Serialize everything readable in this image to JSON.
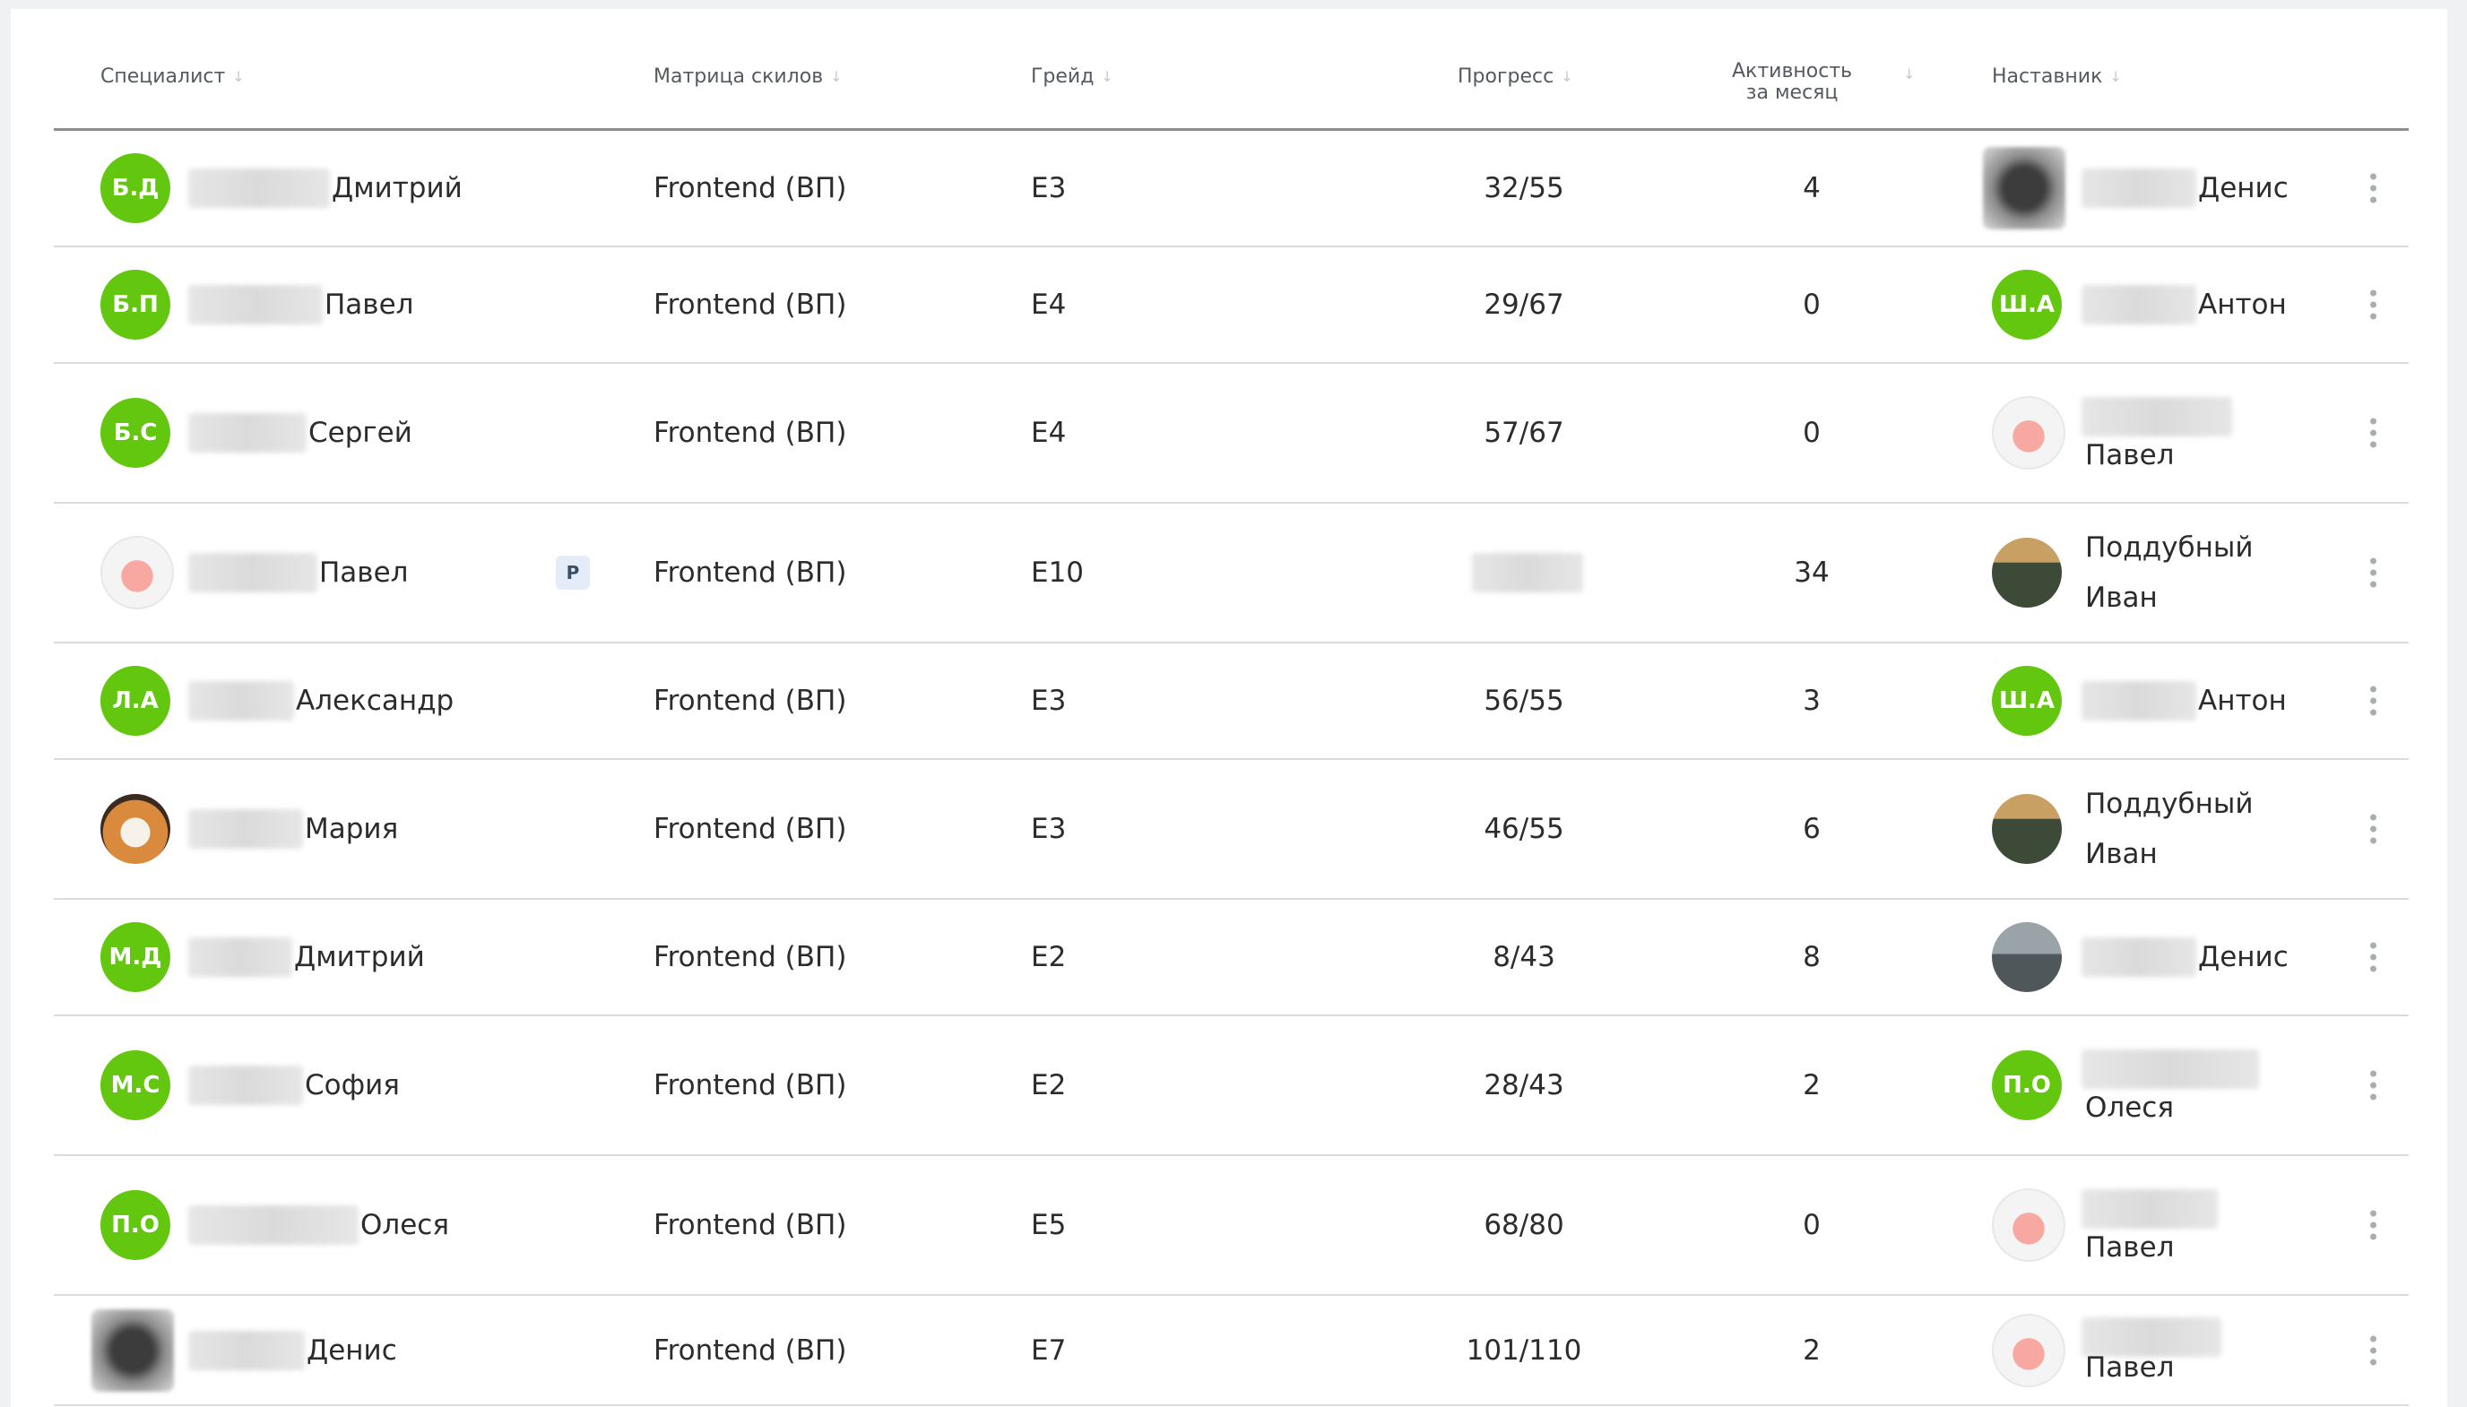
{
  "headers": {
    "specialist": "Специалист",
    "matrix": "Матрица скилов",
    "grade": "Грейд",
    "progress": "Прогресс",
    "activity_line1": "Активность",
    "activity_line2": "за месяц",
    "mentor": "Наставник"
  },
  "rows": [
    {
      "initials": "Б.Д",
      "avatar": "initials",
      "name": "Дмитрий",
      "matrix": "Frontend (ВП)",
      "grade": "E3",
      "progress": "32/55",
      "activity": "4",
      "mentor_avatar": "blur-photo",
      "mentor_line1": "Денис",
      "mentor_line2": ""
    },
    {
      "initials": "Б.П",
      "avatar": "initials",
      "name": "Павел",
      "matrix": "Frontend (ВП)",
      "grade": "E4",
      "progress": "29/67",
      "activity": "0",
      "mentor_avatar": "initials",
      "mentor_initials": "Ш.А",
      "mentor_line1": "Антон",
      "mentor_line2": ""
    },
    {
      "initials": "Б.С",
      "avatar": "initials",
      "name": "Сергей",
      "matrix": "Frontend (ВП)",
      "grade": "E4",
      "progress": "57/67",
      "activity": "0",
      "mentor_avatar": "pig-icon",
      "mentor_line1": "",
      "mentor_line2": "Павел"
    },
    {
      "initials": "",
      "avatar": "pig-icon",
      "name": "Павел",
      "badge": "P",
      "matrix": "Frontend (ВП)",
      "grade": "E10",
      "progress": "",
      "activity": "34",
      "mentor_avatar": "man-photo",
      "mentor_line1": "Поддубный",
      "mentor_line2": "Иван"
    },
    {
      "initials": "Л.А",
      "avatar": "initials",
      "name": "Александр",
      "matrix": "Frontend (ВП)",
      "grade": "E3",
      "progress": "56/55",
      "activity": "3",
      "mentor_avatar": "initials",
      "mentor_initials": "Ш.А",
      "mentor_line1": "Антон",
      "mentor_line2": ""
    },
    {
      "initials": "",
      "avatar": "dog-photo",
      "name": "Мария",
      "matrix": "Frontend (ВП)",
      "grade": "E3",
      "progress": "46/55",
      "activity": "6",
      "mentor_avatar": "man-photo",
      "mentor_line1": "Поддубный",
      "mentor_line2": "Иван"
    },
    {
      "initials": "М.Д",
      "avatar": "initials",
      "name": "Дмитрий",
      "matrix": "Frontend (ВП)",
      "grade": "E2",
      "progress": "8/43",
      "activity": "8",
      "mentor_avatar": "road-photo",
      "mentor_line1": "Денис",
      "mentor_line2": ""
    },
    {
      "initials": "М.С",
      "avatar": "initials",
      "name": "София",
      "matrix": "Frontend (ВП)",
      "grade": "E2",
      "progress": "28/43",
      "activity": "2",
      "mentor_avatar": "initials",
      "mentor_initials": "П.О",
      "mentor_line1": "",
      "mentor_line2": "Олеся"
    },
    {
      "initials": "П.О",
      "avatar": "initials",
      "name": "Олеся",
      "matrix": "Frontend (ВП)",
      "grade": "E5",
      "progress": "68/80",
      "activity": "0",
      "mentor_avatar": "pig-icon",
      "mentor_line1": "",
      "mentor_line2": "Павел"
    },
    {
      "initials": "",
      "avatar": "blur-photo",
      "name": "Денис",
      "matrix": "Frontend (ВП)",
      "grade": "E7",
      "progress": "101/110",
      "activity": "2",
      "mentor_avatar": "pig-icon",
      "mentor_line1": "",
      "mentor_line2": "Павел"
    }
  ],
  "colors": {
    "initials_bg": "#62c70e",
    "header_rule": "#8e8e8e",
    "row_rule": "#d9dcdf"
  }
}
